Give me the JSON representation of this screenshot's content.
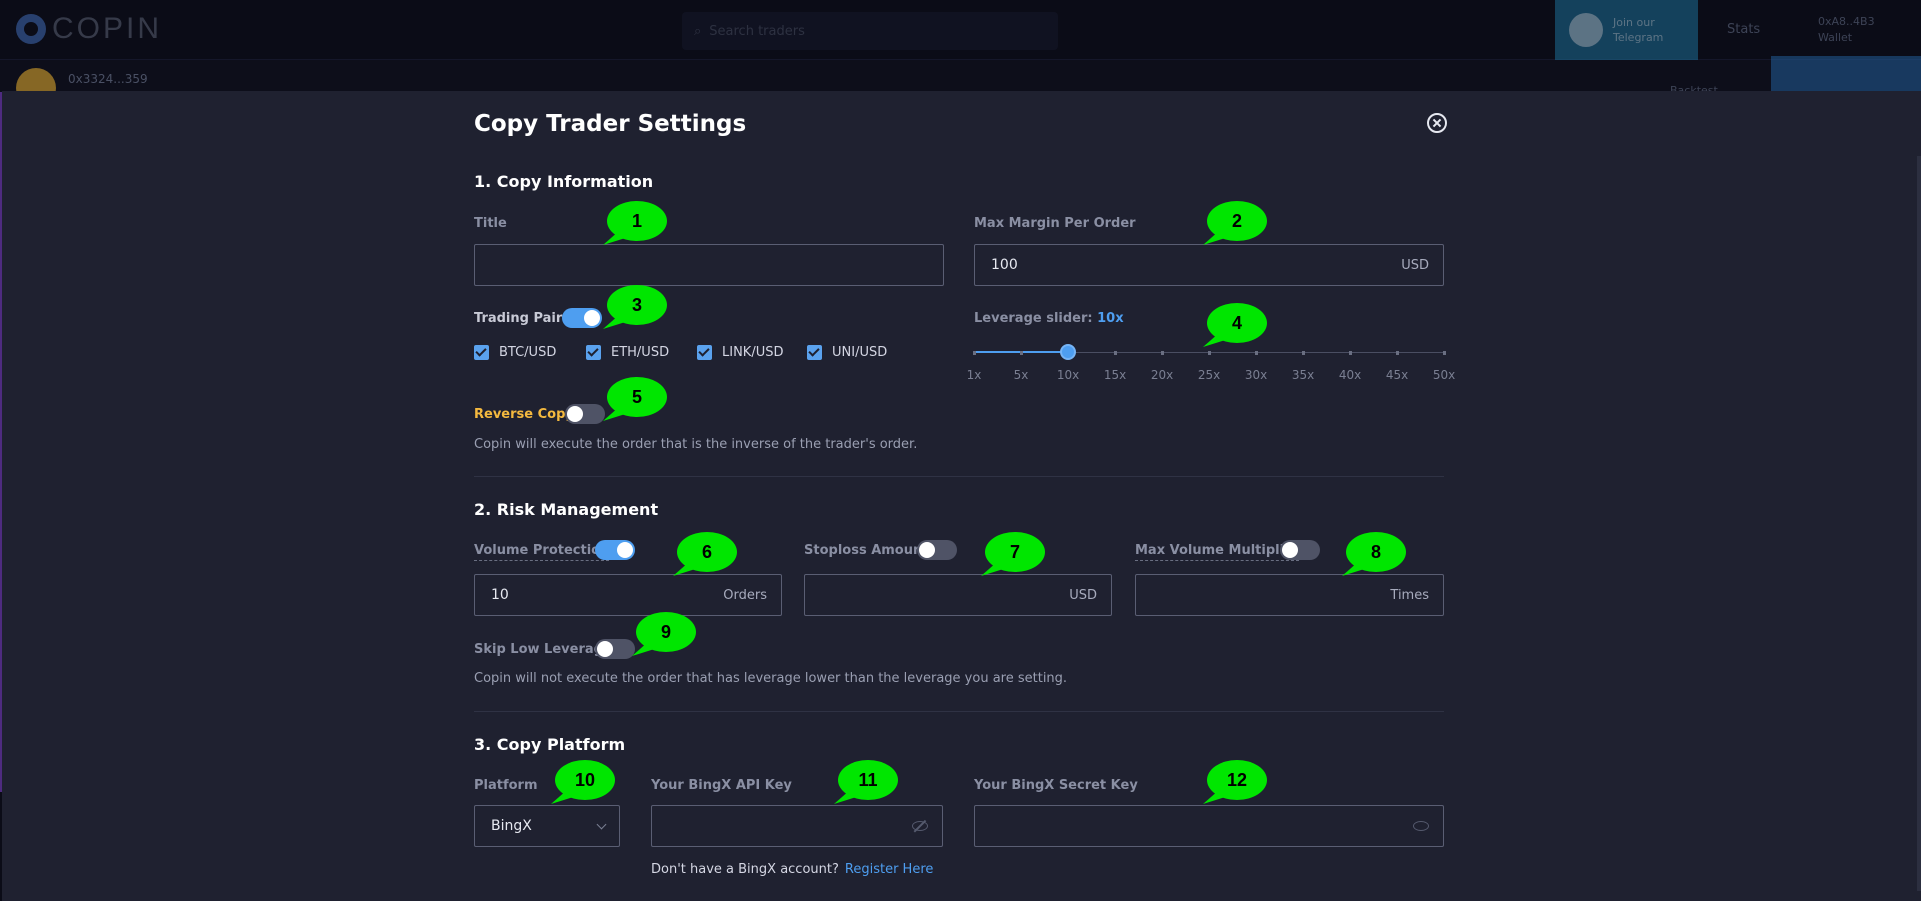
{
  "background": {
    "logo_text": "COPIN",
    "search_placeholder": "Search traders",
    "telegram_lines": [
      "Join our",
      "Telegram"
    ],
    "top_link": "Stats",
    "user_line1": "0xA8..4B3",
    "user_line2": "Wallet",
    "sub_name": "0x3324...359",
    "sub_btn2": "Backtest"
  },
  "modal": {
    "title": "Copy Trader Settings"
  },
  "section1": {
    "title": "1. Copy Information",
    "title_label": "Title",
    "title_value": "",
    "max_margin_label": "Max Margin Per Order",
    "max_margin_value": "100",
    "max_margin_unit": "USD",
    "trading_pairs_label": "Trading Pairs",
    "trading_pairs_enabled": true,
    "pairs": [
      "BTC/USD",
      "ETH/USD",
      "LINK/USD",
      "UNI/USD"
    ],
    "leverage_label": "Leverage slider:",
    "leverage_value": "10x",
    "leverage_value_num": 10,
    "leverage_ticks": [
      "1x",
      "5x",
      "10x",
      "15x",
      "20x",
      "25x",
      "30x",
      "35x",
      "40x",
      "45x",
      "50x"
    ],
    "reverse_label": "Reverse Copy",
    "reverse_enabled": false,
    "reverse_desc": "Copin will execute the order that is the inverse of the trader's order."
  },
  "section2": {
    "title": "2. Risk Management",
    "volume_protection_label": "Volume Protection",
    "volume_protection_enabled": true,
    "volume_value": "10",
    "volume_unit": "Orders",
    "stoploss_label": "Stoploss Amount",
    "stoploss_enabled": false,
    "stoploss_unit": "USD",
    "max_volume_label": "Max Volume Multiplier",
    "max_volume_enabled": false,
    "max_volume_unit": "Times",
    "skip_low_label": "Skip Low Leverage",
    "skip_low_enabled": false,
    "skip_low_desc": "Copin will not execute the order that has leverage lower than the leverage you are setting."
  },
  "section3": {
    "title": "3. Copy Platform",
    "platform_label": "Platform",
    "platform_value": "BingX",
    "api_key_label": "Your BingX API Key",
    "secret_key_label": "Your BingX Secret Key",
    "no_account_text": "Don't have a BingX account?",
    "register_link": "Register Here"
  },
  "annotations": [
    "1",
    "2",
    "3",
    "4",
    "5",
    "6",
    "7",
    "8",
    "9",
    "10",
    "11",
    "12"
  ],
  "colors": {
    "accent": "#4e9ef0",
    "annotation_green": "#00e600",
    "reverse_label": "#f4b93f",
    "modal_bg": "#1f2130"
  }
}
